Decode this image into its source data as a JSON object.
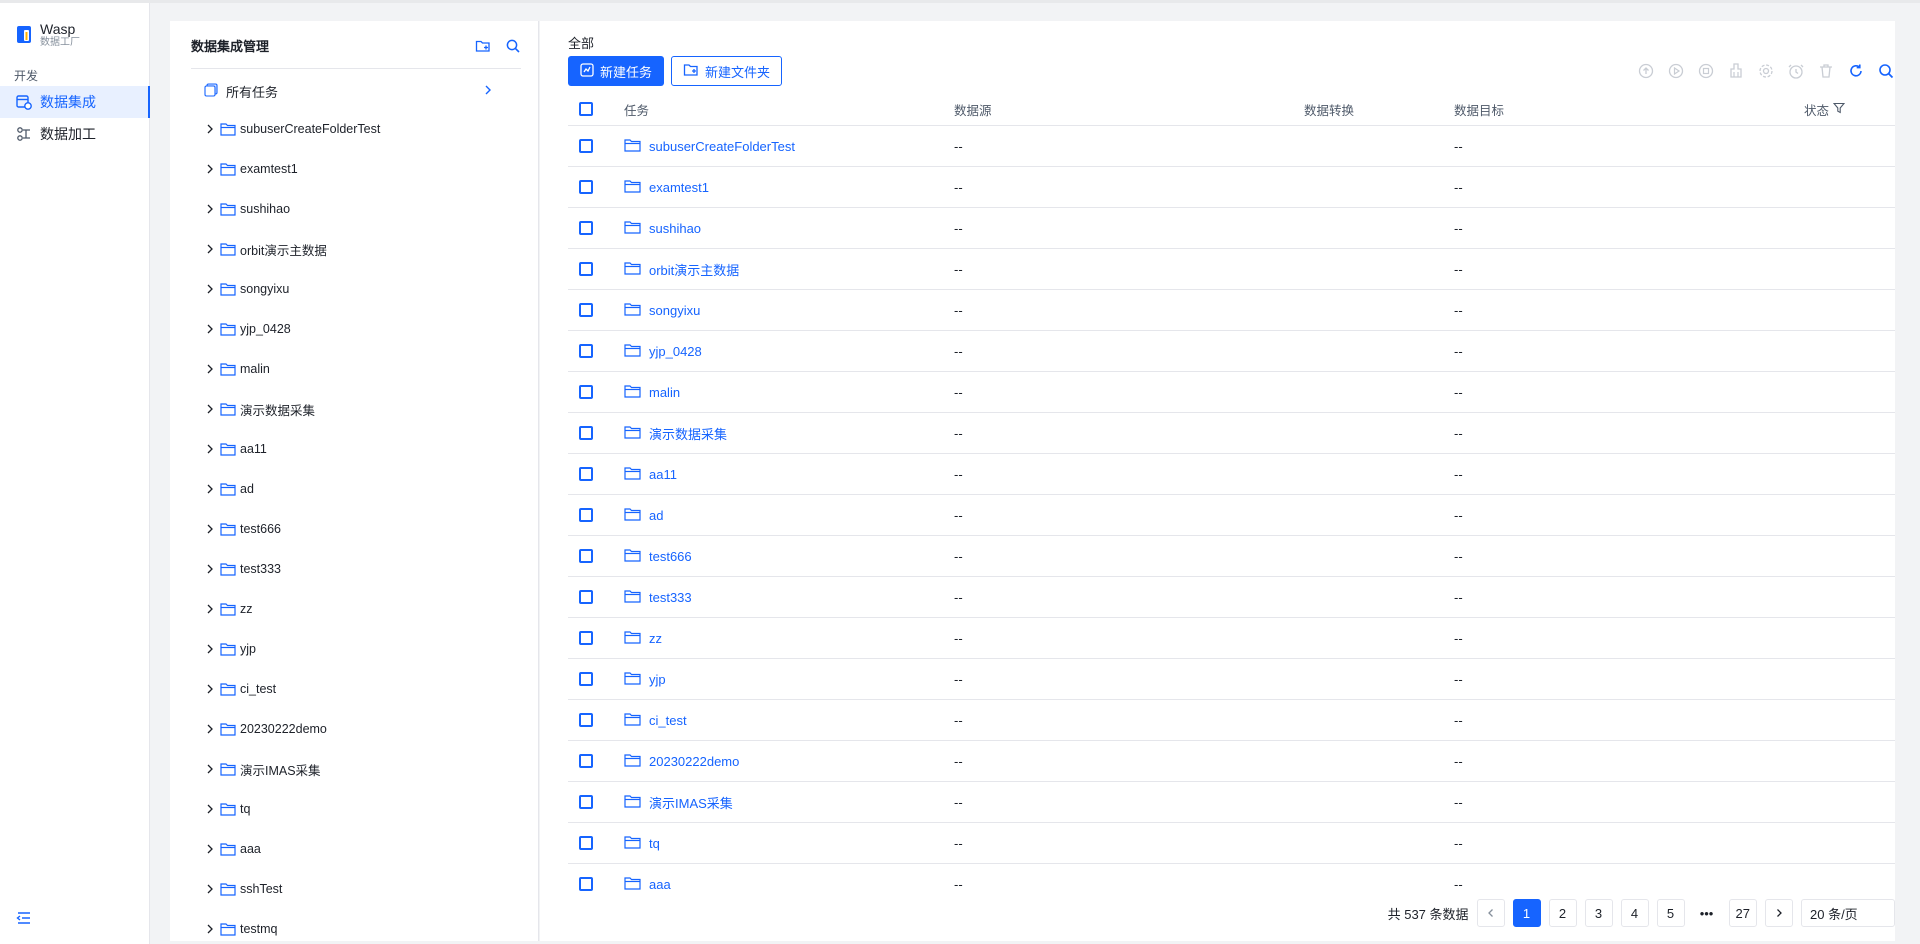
{
  "app": {
    "name": "Wasp",
    "subtitle": "数据工厂"
  },
  "nav": {
    "section": "开发",
    "items": [
      {
        "label": "数据集成",
        "icon": "data-integration-icon",
        "active": true
      },
      {
        "label": "数据加工",
        "icon": "data-processing-icon",
        "active": false
      }
    ]
  },
  "tree": {
    "title": "数据集成管理",
    "all_label": "所有任务",
    "items": [
      "subuserCreateFolderTest",
      "examtest1",
      "sushihao",
      "orbit演示主数据",
      "songyixu",
      "yjp_0428",
      "malin",
      "演示数据采集",
      "aa11",
      "ad",
      "test666",
      "test333",
      "zz",
      "yjp",
      "ci_test",
      "20230222demo",
      "演示IMAS采集",
      "tq",
      "aaa",
      "sshTest",
      "testmq"
    ]
  },
  "main": {
    "breadcrumb": "全部",
    "new_task": "新建任务",
    "new_folder": "新建文件夹",
    "columns": {
      "task": "任务",
      "source": "数据源",
      "transform": "数据转换",
      "target": "数据目标",
      "status": "状态"
    },
    "rows": [
      {
        "name": "subuserCreateFolderTest",
        "source": "--",
        "target": "--"
      },
      {
        "name": "examtest1",
        "source": "--",
        "target": "--"
      },
      {
        "name": "sushihao",
        "source": "--",
        "target": "--"
      },
      {
        "name": "orbit演示主数据",
        "source": "--",
        "target": "--"
      },
      {
        "name": "songyixu",
        "source": "--",
        "target": "--"
      },
      {
        "name": "yjp_0428",
        "source": "--",
        "target": "--"
      },
      {
        "name": "malin",
        "source": "--",
        "target": "--"
      },
      {
        "name": "演示数据采集",
        "source": "--",
        "target": "--"
      },
      {
        "name": "aa11",
        "source": "--",
        "target": "--"
      },
      {
        "name": "ad",
        "source": "--",
        "target": "--"
      },
      {
        "name": "test666",
        "source": "--",
        "target": "--"
      },
      {
        "name": "test333",
        "source": "--",
        "target": "--"
      },
      {
        "name": "zz",
        "source": "--",
        "target": "--"
      },
      {
        "name": "yjp",
        "source": "--",
        "target": "--"
      },
      {
        "name": "ci_test",
        "source": "--",
        "target": "--"
      },
      {
        "name": "20230222demo",
        "source": "--",
        "target": "--"
      },
      {
        "name": "演示IMAS采集",
        "source": "--",
        "target": "--"
      },
      {
        "name": "tq",
        "source": "--",
        "target": "--"
      },
      {
        "name": "aaa",
        "source": "--",
        "target": "--"
      }
    ],
    "pagination": {
      "total_text": "共 537 条数据",
      "pages": [
        "1",
        "2",
        "3",
        "4",
        "5"
      ],
      "ellipsis": "•••",
      "last_page": "27",
      "page_size": "20 条/页"
    }
  },
  "colors": {
    "accent": "#1664ff",
    "border": "#e5e6eb",
    "bg": "#f2f3f5"
  }
}
